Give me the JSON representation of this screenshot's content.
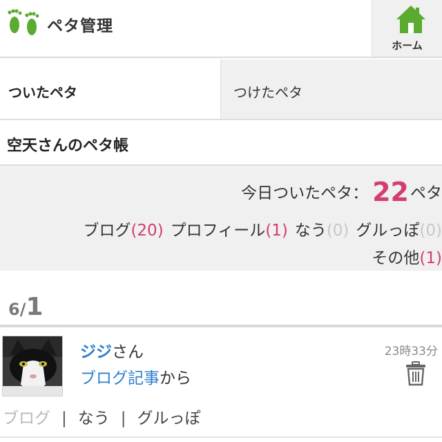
{
  "header": {
    "title": "ペタ管理",
    "home_label": "ホーム",
    "logo_icon": "footprints-icon",
    "home_icon": "house-icon",
    "accent_color": "#5aab2f"
  },
  "tabs": [
    {
      "label": "ついたペタ",
      "active": true
    },
    {
      "label": "つけたペタ",
      "active": false
    }
  ],
  "section_title": "空天さんのペタ帳",
  "stats": {
    "today_label": "今日ついたペタ：",
    "today_count": "22",
    "today_unit": "ペタ",
    "categories": [
      {
        "label": "ブログ",
        "count": "(20)"
      },
      {
        "label": "プロフィール",
        "count": "(1)"
      },
      {
        "label": "なう",
        "count": "(0)"
      },
      {
        "label": "グルっぽ",
        "count": "(0)"
      },
      {
        "label": "その他",
        "count": "(1)"
      }
    ],
    "highlight_color": "#d43d6e"
  },
  "pager": {
    "current": "6/",
    "total": "1"
  },
  "entries": [
    {
      "avatar": "cat-photo",
      "name": "ジジ",
      "suffix": "さん",
      "time": "23時33分",
      "source": "ブログ記事",
      "source_suffix": "から",
      "delete_icon": "trash-icon",
      "actions": [
        "ブログ",
        "なう",
        "グルっぽ"
      ],
      "separator": "|"
    }
  ]
}
